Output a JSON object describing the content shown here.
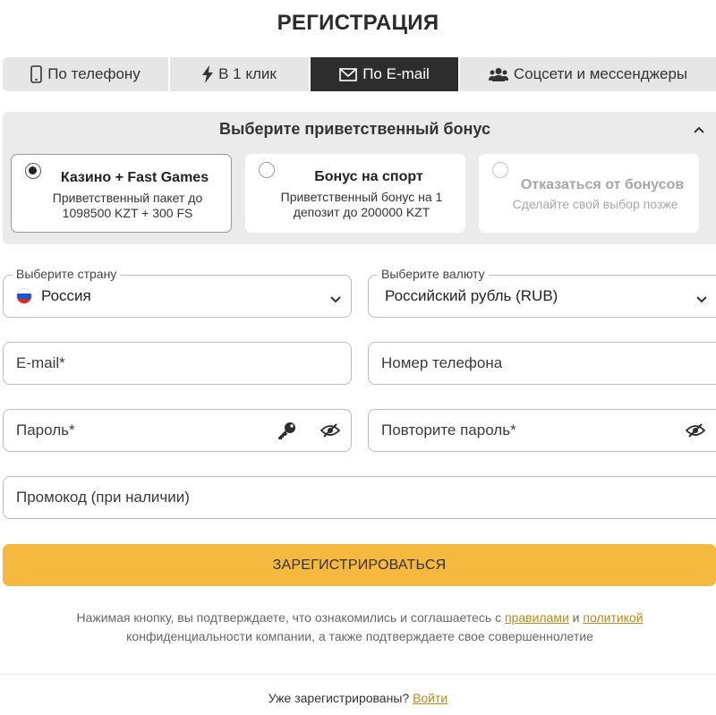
{
  "page_title": "РЕГИСТРАЦИЯ",
  "tabs": [
    {
      "label": "По телефону",
      "icon": "phone-icon",
      "active": false
    },
    {
      "label": "В 1 клик",
      "icon": "lightning-icon",
      "active": false
    },
    {
      "label": "По E-mail",
      "icon": "envelope-icon",
      "active": true
    },
    {
      "label": "Соцсети и мессенджеры",
      "icon": "users-icon",
      "active": false
    }
  ],
  "bonus": {
    "title": "Выберите приветственный бонус",
    "options": [
      {
        "title": "Казино + Fast Games",
        "desc": "Приветственный пакет до 1098500 KZT + 300 FS",
        "selected": true
      },
      {
        "title": "Бонус на спорт",
        "desc": "Приветственный бонус на 1 депозит до 200000 KZT",
        "selected": false
      },
      {
        "title": "Отказаться от бонусов",
        "desc": "Сделайте свой выбор позже",
        "selected": false
      }
    ]
  },
  "form": {
    "country_label": "Выберите страну",
    "country_value": "Россия",
    "currency_label": "Выберите валюту",
    "currency_value": "Российский рубль (RUB)",
    "email_placeholder": "E-mail*",
    "phone_placeholder": "Номер телефона",
    "password_placeholder": "Пароль*",
    "repeat_password_placeholder": "Повторите пароль*",
    "promo_placeholder": "Промокод (при наличии)"
  },
  "register_button": "ЗАРЕГИСТРИРОВАТЬСЯ",
  "terms": {
    "text_before": "Нажимая кнопку, вы подтверждаете, что ознакомились и соглашаетесь с ",
    "rules_link": "правилами",
    "and": " и ",
    "policy_link": "политикой",
    "text_after": " конфиденциальности компании, а также подтверждаете свое совершеннолетие"
  },
  "login": {
    "question": "Уже зарегистрированы? ",
    "link": "Войти"
  },
  "colors": {
    "accent": "#f5b940",
    "active_tab": "#2d2d2d",
    "link": "#b88a1a",
    "panel": "#ebebeb"
  }
}
